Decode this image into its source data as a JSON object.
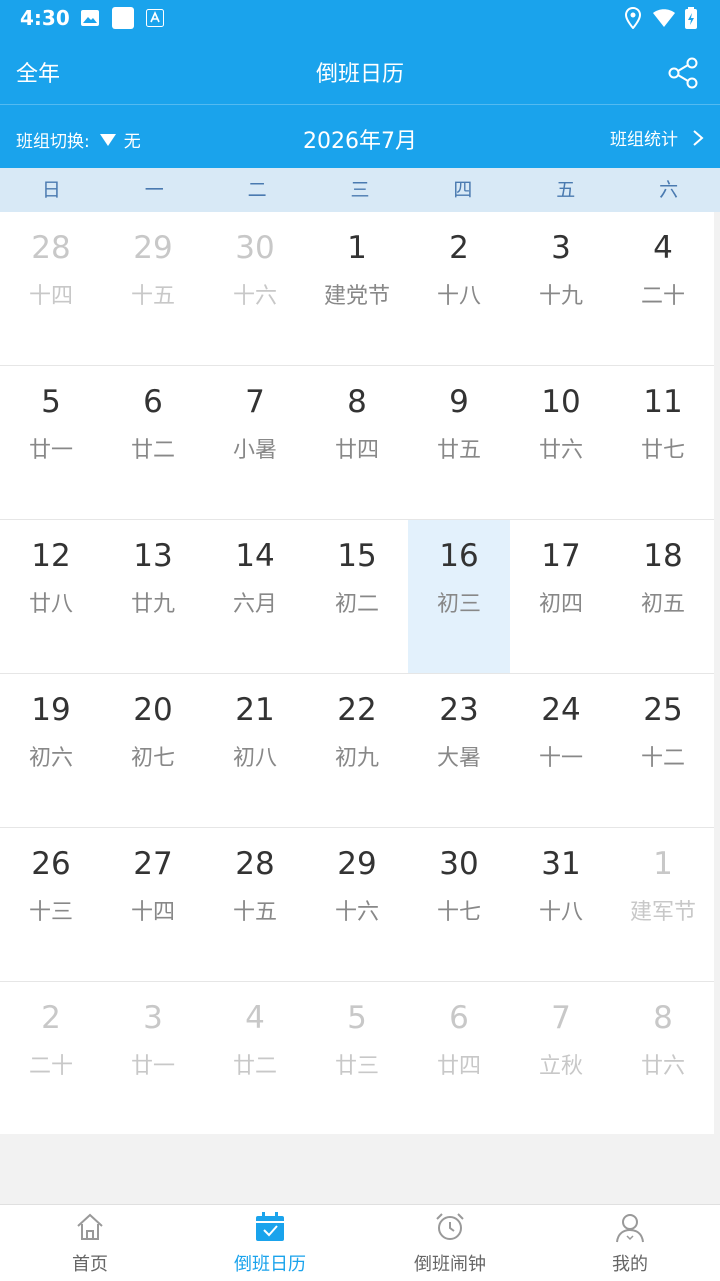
{
  "status": {
    "time": "4:30"
  },
  "appbar": {
    "left": "全年",
    "title": "倒班日历"
  },
  "subbar": {
    "switch_label": "班组切换:",
    "switch_value": "无",
    "month": "2026年7月",
    "stats": "班组统计"
  },
  "weekdays": [
    "日",
    "一",
    "二",
    "三",
    "四",
    "五",
    "六"
  ],
  "weeks": [
    [
      {
        "d": "28",
        "l": "十四",
        "o": true
      },
      {
        "d": "29",
        "l": "十五",
        "o": true
      },
      {
        "d": "30",
        "l": "十六",
        "o": true
      },
      {
        "d": "1",
        "l": "建党节"
      },
      {
        "d": "2",
        "l": "十八"
      },
      {
        "d": "3",
        "l": "十九"
      },
      {
        "d": "4",
        "l": "二十"
      }
    ],
    [
      {
        "d": "5",
        "l": "廿一"
      },
      {
        "d": "6",
        "l": "廿二"
      },
      {
        "d": "7",
        "l": "小暑"
      },
      {
        "d": "8",
        "l": "廿四"
      },
      {
        "d": "9",
        "l": "廿五"
      },
      {
        "d": "10",
        "l": "廿六"
      },
      {
        "d": "11",
        "l": "廿七"
      }
    ],
    [
      {
        "d": "12",
        "l": "廿八"
      },
      {
        "d": "13",
        "l": "廿九"
      },
      {
        "d": "14",
        "l": "六月"
      },
      {
        "d": "15",
        "l": "初二"
      },
      {
        "d": "16",
        "l": "初三",
        "s": true
      },
      {
        "d": "17",
        "l": "初四"
      },
      {
        "d": "18",
        "l": "初五"
      }
    ],
    [
      {
        "d": "19",
        "l": "初六"
      },
      {
        "d": "20",
        "l": "初七"
      },
      {
        "d": "21",
        "l": "初八"
      },
      {
        "d": "22",
        "l": "初九"
      },
      {
        "d": "23",
        "l": "大暑"
      },
      {
        "d": "24",
        "l": "十一"
      },
      {
        "d": "25",
        "l": "十二"
      }
    ],
    [
      {
        "d": "26",
        "l": "十三"
      },
      {
        "d": "27",
        "l": "十四"
      },
      {
        "d": "28",
        "l": "十五"
      },
      {
        "d": "29",
        "l": "十六"
      },
      {
        "d": "30",
        "l": "十七"
      },
      {
        "d": "31",
        "l": "十八"
      },
      {
        "d": "1",
        "l": "建军节",
        "o": true
      }
    ],
    [
      {
        "d": "2",
        "l": "二十",
        "o": true
      },
      {
        "d": "3",
        "l": "廿一",
        "o": true
      },
      {
        "d": "4",
        "l": "廿二",
        "o": true
      },
      {
        "d": "5",
        "l": "廿三",
        "o": true
      },
      {
        "d": "6",
        "l": "廿四",
        "o": true
      },
      {
        "d": "7",
        "l": "立秋",
        "o": true
      },
      {
        "d": "8",
        "l": "廿六",
        "o": true
      }
    ]
  ],
  "nav": [
    {
      "label": "首页",
      "icon": "home-icon"
    },
    {
      "label": "倒班日历",
      "icon": "calendar-icon",
      "active": true
    },
    {
      "label": "倒班闹钟",
      "icon": "alarm-clock-icon"
    },
    {
      "label": "我的",
      "icon": "profile-icon"
    }
  ],
  "colors": {
    "primary": "#1aa3ec",
    "selected": "#e3f1fc",
    "weekheader": "#d8e9f6"
  }
}
